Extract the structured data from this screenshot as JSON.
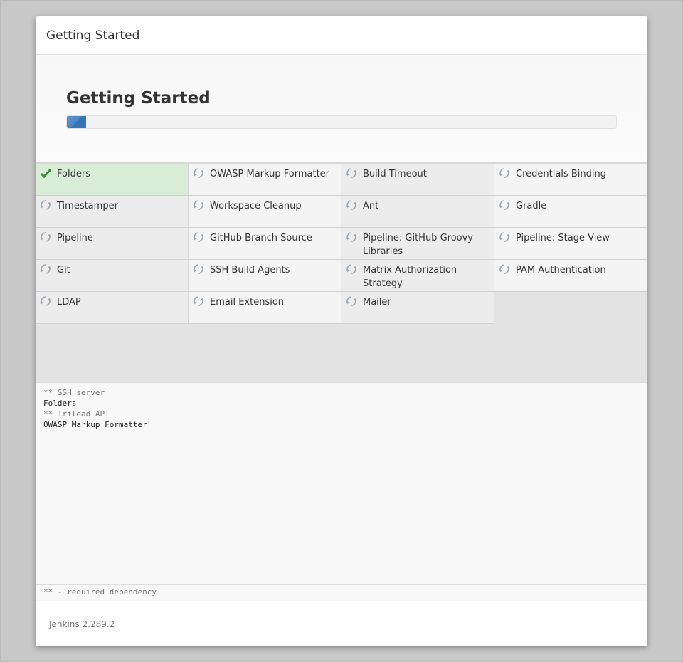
{
  "header": {
    "title": "Getting Started"
  },
  "hero": {
    "title": "Getting Started",
    "progress": 0.035,
    "progress_color": "#4a86c5"
  },
  "plugins": [
    {
      "label": "Folders",
      "status": "installed",
      "icon": "check-icon"
    },
    {
      "label": "OWASP Markup Formatter",
      "status": "pending",
      "icon": "refresh-icon"
    },
    {
      "label": "Build Timeout",
      "status": "pending",
      "icon": "refresh-icon"
    },
    {
      "label": "Credentials Binding",
      "status": "pending",
      "icon": "refresh-icon"
    },
    {
      "label": "Timestamper",
      "status": "pending",
      "icon": "refresh-icon"
    },
    {
      "label": "Workspace Cleanup",
      "status": "pending",
      "icon": "refresh-icon"
    },
    {
      "label": "Ant",
      "status": "pending",
      "icon": "refresh-icon"
    },
    {
      "label": "Gradle",
      "status": "pending",
      "icon": "refresh-icon"
    },
    {
      "label": "Pipeline",
      "status": "pending",
      "icon": "refresh-icon"
    },
    {
      "label": "GitHub Branch Source",
      "status": "pending",
      "icon": "refresh-icon"
    },
    {
      "label": "Pipeline: GitHub Groovy Libraries",
      "status": "pending",
      "icon": "refresh-icon"
    },
    {
      "label": "Pipeline: Stage View",
      "status": "pending",
      "icon": "refresh-icon"
    },
    {
      "label": "Git",
      "status": "pending",
      "icon": "refresh-icon"
    },
    {
      "label": "SSH Build Agents",
      "status": "pending",
      "icon": "refresh-icon"
    },
    {
      "label": "Matrix Authorization Strategy",
      "status": "pending",
      "icon": "refresh-icon"
    },
    {
      "label": "PAM Authentication",
      "status": "pending",
      "icon": "refresh-icon"
    },
    {
      "label": "LDAP",
      "status": "pending",
      "icon": "refresh-icon"
    },
    {
      "label": "Email Extension",
      "status": "pending",
      "icon": "refresh-icon"
    },
    {
      "label": "Mailer",
      "status": "pending",
      "icon": "refresh-icon"
    }
  ],
  "log": [
    {
      "text": "** SSH server",
      "kind": "dep"
    },
    {
      "text": "Folders",
      "kind": "name"
    },
    {
      "text": "** Trilead API",
      "kind": "dep"
    },
    {
      "text": "OWASP Markup Formatter",
      "kind": "name"
    }
  ],
  "dependency_note": "** - required dependency",
  "footer": {
    "version": "Jenkins 2.289.2"
  },
  "colors": {
    "installed_bg": "#d9ecd8",
    "check": "#3c8a3a",
    "refresh": "#9aa9b6"
  }
}
